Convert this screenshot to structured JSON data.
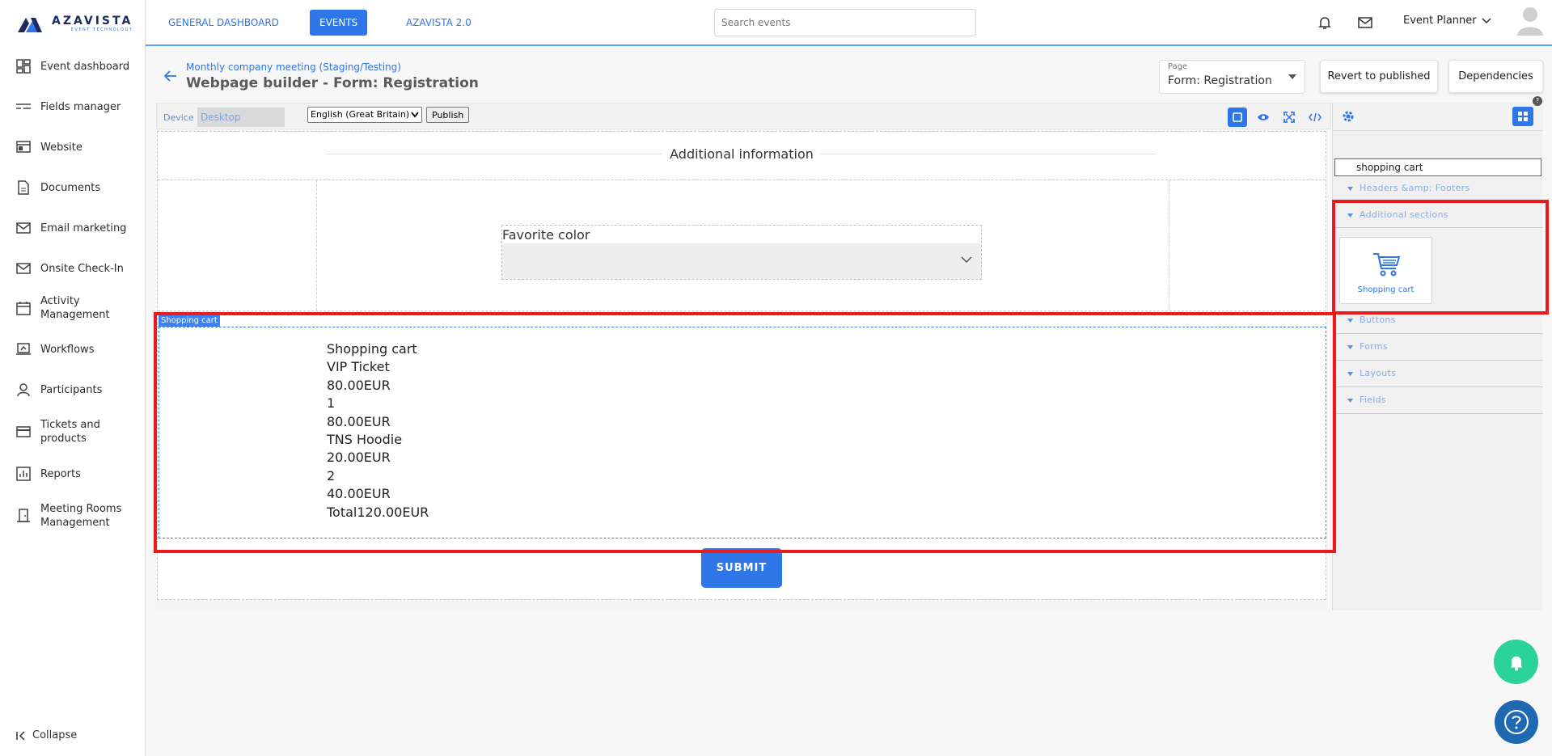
{
  "brand": {
    "name": "AZAVISTA",
    "tagline": "EVENT TECHNOLOGY"
  },
  "sidebar": {
    "items": [
      {
        "label": "Event dashboard",
        "icon": "dashboard-icon"
      },
      {
        "label": "Fields manager",
        "icon": "fields-icon"
      },
      {
        "label": "Website",
        "icon": "website-icon"
      },
      {
        "label": "Documents",
        "icon": "document-icon"
      },
      {
        "label": "Email marketing",
        "icon": "mail-icon"
      },
      {
        "label": "Onsite Check-In",
        "icon": "mail-icon"
      },
      {
        "label": "Activity Management",
        "icon": "calendar-icon"
      },
      {
        "label": "Workflows",
        "icon": "workflow-icon"
      },
      {
        "label": "Participants",
        "icon": "person-icon"
      },
      {
        "label": "Tickets and products",
        "icon": "card-icon"
      },
      {
        "label": "Reports",
        "icon": "chart-icon"
      },
      {
        "label": "Meeting Rooms Management",
        "icon": "door-icon"
      }
    ],
    "collapse_label": "Collapse"
  },
  "topbar": {
    "tabs": [
      {
        "label": "GENERAL DASHBOARD",
        "active": false
      },
      {
        "label": "EVENTS",
        "active": true
      },
      {
        "label": "AZAVISTA 2.0",
        "active": false
      }
    ],
    "search_placeholder": "Search events",
    "user_label": "Event Planner"
  },
  "header": {
    "breadcrumb": "Monthly company meeting (Staging/Testing)",
    "title": "Webpage builder - Form: Registration",
    "page_select": {
      "label": "Page",
      "value": "Form: Registration"
    },
    "revert_label": "Revert to published",
    "dependencies_label": "Dependencies"
  },
  "editor_toolbar": {
    "device_label": "Device",
    "device_value": "Desktop",
    "language_value": "English (Great Britain)",
    "publish_label": "Publish"
  },
  "canvas": {
    "section_title": "Additional information",
    "field_label": "Favorite color",
    "cart_tag": "Shopping cart",
    "cart_lines": [
      "Shopping cart",
      "VIP Ticket",
      "80.00EUR",
      "1",
      "80.00EUR",
      "TNS Hoodie",
      "20.00EUR",
      "2",
      "40.00EUR",
      "Total120.00EUR"
    ],
    "submit_label": "SUBMIT"
  },
  "right_panel": {
    "search_value": "shopping cart",
    "help_badge": "?",
    "categories": [
      "Headers &amp; Footers",
      "Additional sections",
      "Buttons",
      "Forms",
      "Layouts",
      "Fields"
    ],
    "block_label": "Shopping cart"
  },
  "colors": {
    "accent": "#2f76e8",
    "highlight": "#e81c1c",
    "fab_green": "#2bd39b",
    "fab_blue": "#1f69b3"
  }
}
